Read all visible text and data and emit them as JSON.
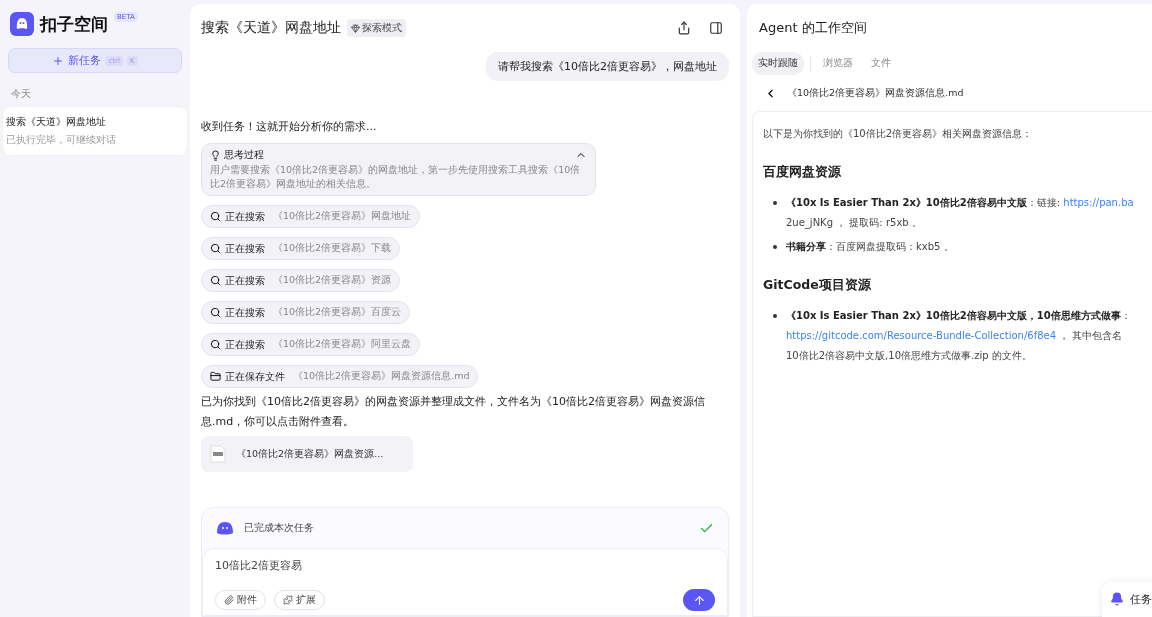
{
  "sidebar": {
    "logo": "扣子空间",
    "badge": "BETA",
    "new_task": {
      "label": "新任务",
      "keys": [
        "ctrl",
        "K"
      ]
    },
    "group": "今天",
    "items": [
      {
        "title": "搜索《天道》网盘地址",
        "subtitle": "已执行完毕，可继续对话",
        "selected": true
      }
    ]
  },
  "chat": {
    "title": "搜索《天道》网盘地址",
    "mode": "探索模式",
    "user_message": "请帮我搜索《10倍比2倍更容易》，网盘地址",
    "intro": "收到任务！这就开始分析你的需求...",
    "thinking": {
      "title": "思考过程",
      "expanded": true,
      "text": "用户需要搜索《10倍比2倍更容易》的网盘地址，第一步先使用搜索工具搜索《10倍比2倍更容易》网盘地址的相关信息。"
    },
    "steps": [
      {
        "kind": "search",
        "action": "正在搜索",
        "detail": "《10倍比2倍更容易》网盘地址"
      },
      {
        "kind": "search",
        "action": "正在搜索",
        "detail": "《10倍比2倍更容易》下载"
      },
      {
        "kind": "search",
        "action": "正在搜索",
        "detail": "《10倍比2倍更容易》资源"
      },
      {
        "kind": "search",
        "action": "正在搜索",
        "detail": "《10倍比2倍更容易》百度云"
      },
      {
        "kind": "search",
        "action": "正在搜索",
        "detail": "《10倍比2倍更容易》阿里云盘"
      },
      {
        "kind": "file",
        "action": "正在保存文件",
        "detail": "《10倍比2倍更容易》网盘资源信息.md"
      }
    ],
    "result": "已为你找到《10倍比2倍更容易》的网盘资源并整理成文件，文件名为《10倍比2倍更容易》网盘资源信息.md，你可以点击附件查看。",
    "attachment": "《10倍比2倍更容易》网盘资源...",
    "status": {
      "text": "已完成本次任务",
      "done": true
    },
    "input": {
      "value": "10倍比2倍更容易",
      "buttons": [
        "附件",
        "扩展"
      ]
    }
  },
  "workspace": {
    "title": "Agent 的工作空间",
    "tabs": [
      {
        "label": "实时跟随",
        "selected": true
      },
      {
        "label": "浏览器",
        "selected": false
      },
      {
        "label": "文件",
        "selected": false
      }
    ],
    "file_name": "《10倍比2倍更容易》网盘资源信息.md",
    "doc": {
      "intro": "以下是为你找到的《10倍比2倍更容易》相关网盘资源信息：",
      "sections": [
        {
          "heading": "百度网盘资源",
          "bullets": [
            {
              "bold": "《10x Is Easier Than 2x》10倍比2倍容易中文版",
              "text": "：链接: ",
              "link": "https://pan.ba",
              "more": [
                "2ue_jNKg ， 提取码: r5xb 。"
              ]
            },
            {
              "bold": "书籍分享",
              "text": "：百度网盘提取码：kxb5 。"
            }
          ]
        },
        {
          "heading": "GitCode项目资源",
          "bullets": [
            {
              "bold": "《10x Is Easier Than 2x》10倍比2倍容易中文版，10倍思维方式做事",
              "text": "：",
              "more_link": "https://gitcode.com/Resource-Bundle-Collection/6f8e4",
              "more_text": " ， 其中包含名",
              "more": [
                "10倍比2倍容易中文版,10倍思维方式做事.zip 的文件。"
              ]
            }
          ]
        }
      ]
    },
    "toast": "任务"
  }
}
